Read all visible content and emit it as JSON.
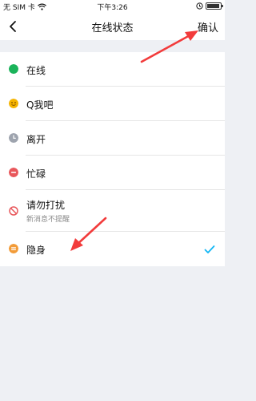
{
  "statusbar": {
    "carrier": "无 SIM 卡",
    "time": "下午3:26"
  },
  "navbar": {
    "title": "在线状态",
    "confirm": "确认"
  },
  "statuses": [
    {
      "label": "在线",
      "icon": "online-dot-icon",
      "color": "#1ab35a"
    },
    {
      "label": "Q我吧",
      "icon": "smile-face-icon",
      "color": "#f5b400"
    },
    {
      "label": "离开",
      "icon": "clock-icon",
      "color": "#9ea4ae"
    },
    {
      "label": "忙碌",
      "icon": "busy-minus-icon",
      "color": "#e8575b"
    },
    {
      "label": "请勿打扰",
      "sub": "新消息不提醒",
      "icon": "do-not-disturb-icon",
      "color": "#e8575b"
    },
    {
      "label": "隐身",
      "icon": "invisible-icon",
      "color": "#f29b38",
      "selected": true
    }
  ],
  "colors": {
    "accent": "#12b7f5",
    "annotation": "#f23b3b",
    "background": "#eef0f4"
  }
}
